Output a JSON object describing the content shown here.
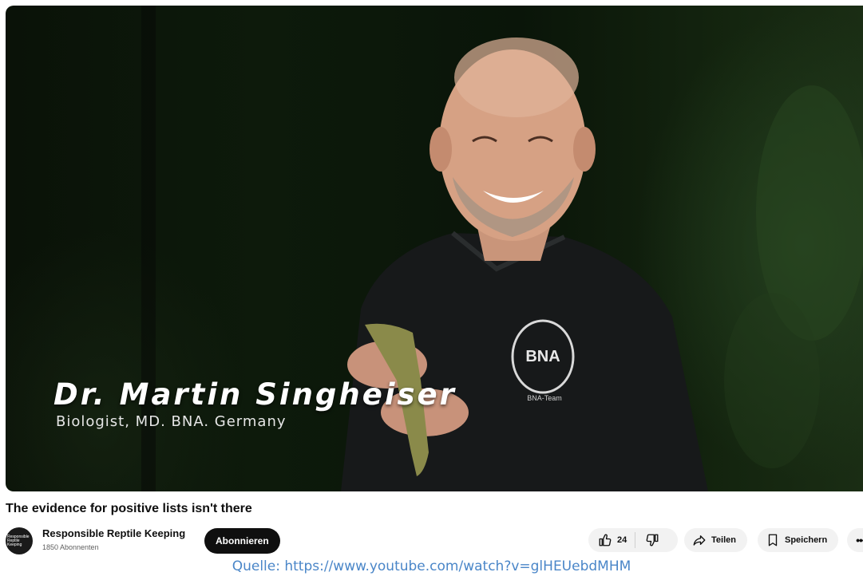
{
  "video": {
    "lower_third_name": "Dr. Martin Singheiser",
    "lower_third_role": "Biologist, MD. BNA. Germany",
    "shirt_logo_text": "BNA",
    "shirt_team_text": "BNA-Team"
  },
  "title": "The evidence for positive lists isn't there",
  "channel": {
    "avatar_text": "Responsible Reptile Keeping",
    "name": "Responsible Reptile Keeping",
    "subscribers": "1850 Abonnenten",
    "subscribe_label": "Abonnieren"
  },
  "actions": {
    "like_count": "24",
    "like_icon": "thumbs-up-icon",
    "dislike_icon": "thumbs-down-icon",
    "share_label": "Teilen",
    "share_icon": "share-arrow-icon",
    "save_label": "Speichern",
    "save_icon": "bookmark-icon",
    "more_label": "•••"
  },
  "source_caption": "Quelle: https://www.youtube.com/watch?v=glHEUebdMHM",
  "colors": {
    "subscribe_bg": "#0f0f0f",
    "pill_bg": "#f2f2f2",
    "caption_link": "#4a86c8"
  }
}
